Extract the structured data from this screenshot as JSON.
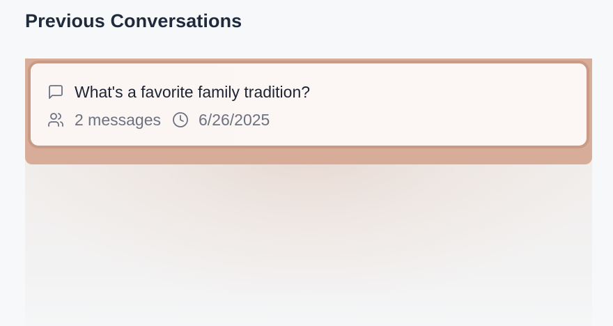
{
  "section": {
    "title": "Previous Conversations"
  },
  "conversations": [
    {
      "title": "What's a favorite family tradition?",
      "messages_label": "2 messages",
      "date": "6/26/2025",
      "title_icon": "message-square-icon",
      "messages_icon": "users-icon",
      "date_icon": "clock-icon"
    }
  ],
  "colors": {
    "selected_border": "#c99a85",
    "selected_band": "#d7ad99",
    "card_background": "#fbf5f3",
    "title_text": "#1c2432",
    "meta_text": "#6b7280",
    "page_background": "#f7f8fa"
  }
}
